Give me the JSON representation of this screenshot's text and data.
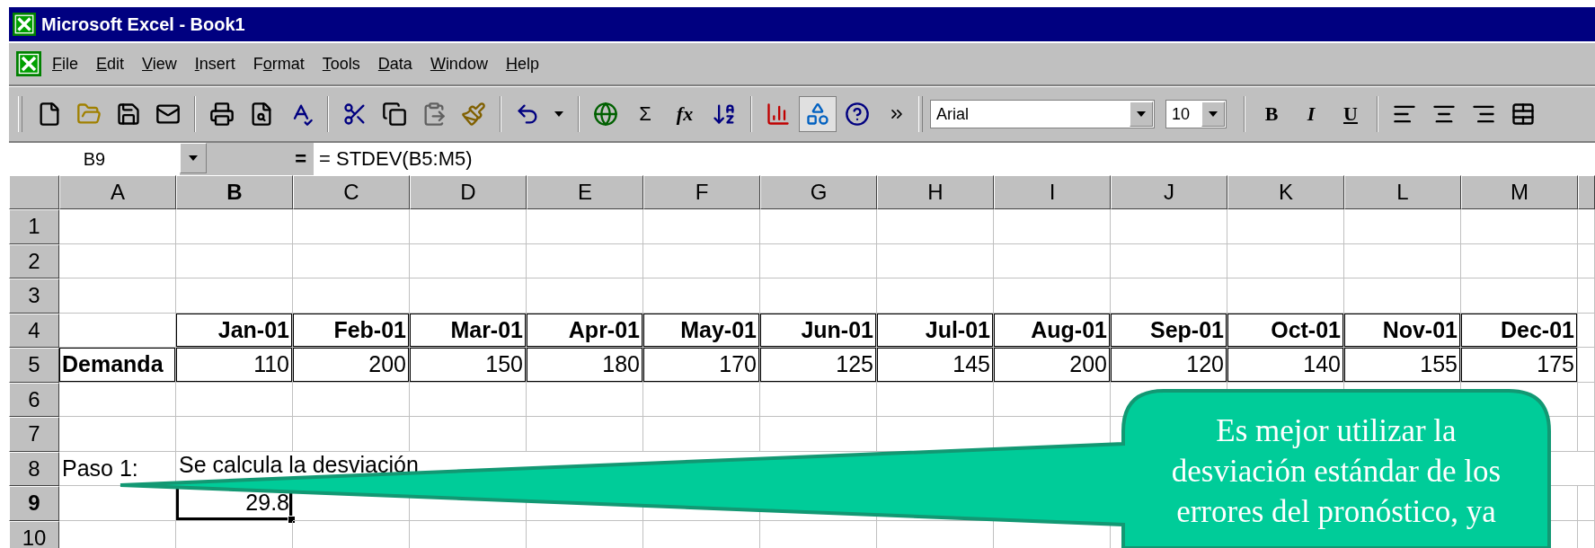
{
  "window": {
    "title": "Microsoft Excel - Book1"
  },
  "menu": [
    {
      "key": "F",
      "post": "ile"
    },
    {
      "key": "E",
      "post": "dit"
    },
    {
      "key": "V",
      "post": "iew"
    },
    {
      "key": "I",
      "post": "nsert"
    },
    {
      "pre": "F",
      "key": "o",
      "post": "rmat"
    },
    {
      "key": "T",
      "post": "ools"
    },
    {
      "key": "D",
      "post": "ata"
    },
    {
      "key": "W",
      "post": "indow"
    },
    {
      "key": "H",
      "post": "elp"
    }
  ],
  "toolbar": {
    "sum": "Σ",
    "function": "fx",
    "drawing_pressed": true,
    "font": "Arial",
    "size": "10",
    "bold": "B",
    "italic": "I",
    "underline": "U"
  },
  "formula_bar": {
    "name_box": "B9",
    "equals": "=",
    "formula": "= STDEV(B5:M5)"
  },
  "columns": [
    {
      "label": "A",
      "selected": false
    },
    {
      "label": "B",
      "selected": true
    },
    {
      "label": "C",
      "selected": false
    },
    {
      "label": "D",
      "selected": false
    },
    {
      "label": "E",
      "selected": false
    },
    {
      "label": "F",
      "selected": false
    },
    {
      "label": "G",
      "selected": false
    },
    {
      "label": "H",
      "selected": false
    },
    {
      "label": "I",
      "selected": false
    },
    {
      "label": "J",
      "selected": false
    },
    {
      "label": "K",
      "selected": false
    },
    {
      "label": "L",
      "selected": false
    },
    {
      "label": "M",
      "selected": false
    }
  ],
  "rows": [
    {
      "header": "1",
      "selected": false,
      "kind": "empty"
    },
    {
      "header": "2",
      "selected": false,
      "kind": "empty"
    },
    {
      "header": "3",
      "selected": false,
      "kind": "empty"
    },
    {
      "header": "4",
      "selected": false,
      "kind": "months",
      "values": [
        "Jan-01",
        "Feb-01",
        "Mar-01",
        "Apr-01",
        "May-01",
        "Jun-01",
        "Jul-01",
        "Aug-01",
        "Sep-01",
        "Oct-01",
        "Nov-01",
        "Dec-01"
      ]
    },
    {
      "header": "5",
      "selected": false,
      "kind": "data",
      "label": "Demanda",
      "values": [
        "110",
        "200",
        "150",
        "180",
        "170",
        "125",
        "145",
        "200",
        "120",
        "140",
        "155",
        "175"
      ]
    },
    {
      "header": "6",
      "selected": false,
      "kind": "empty"
    },
    {
      "header": "7",
      "selected": false,
      "kind": "empty"
    },
    {
      "header": "8",
      "selected": false,
      "kind": "note",
      "label": "Paso 1:",
      "note": "Se calcula la desviación"
    },
    {
      "header": "9",
      "selected": true,
      "kind": "result",
      "value": "29.8"
    },
    {
      "header": "10",
      "selected": false,
      "kind": "empty"
    }
  ],
  "callout": {
    "text": "Es mejor utilizar la desviación estándar de los errores del pronóstico, ya"
  }
}
